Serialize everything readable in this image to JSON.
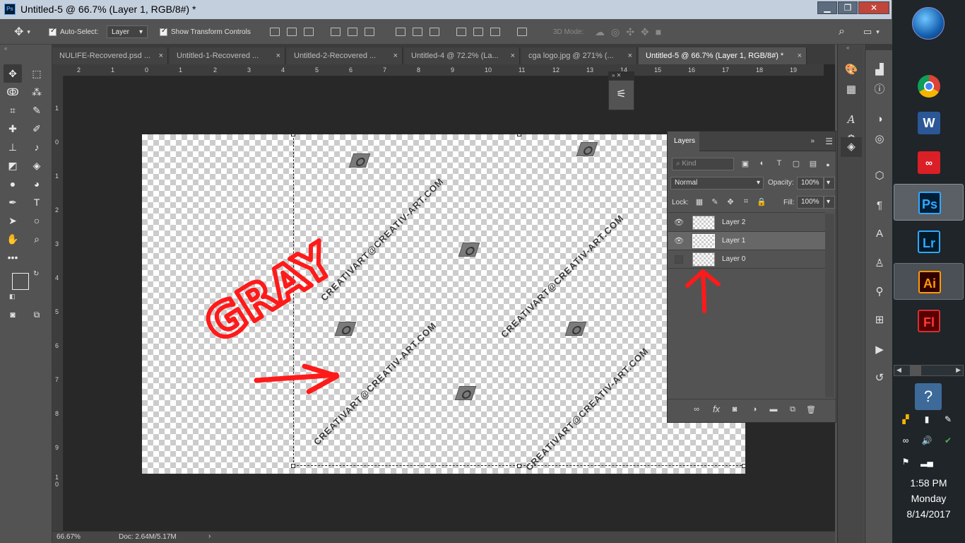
{
  "window": {
    "title": "Untitled-5 @ 66.7% (Layer 1, RGB/8#) *",
    "app_icon": "Ps",
    "min": "▁",
    "restore": "❐",
    "close": "✕"
  },
  "options": {
    "auto_select_label": "Auto-Select:",
    "auto_select_value": "Layer",
    "show_transform_label": "Show Transform Controls",
    "mode_3d_label": "3D Mode:"
  },
  "tabs": [
    {
      "label": "NULIFE-Recovered.psd ...",
      "close": "×"
    },
    {
      "label": "Untitled-1-Recovered ...",
      "close": "×"
    },
    {
      "label": "Untitled-2-Recovered ...",
      "close": "×"
    },
    {
      "label": "Untitled-4 @ 72.2% (La...",
      "close": "×"
    },
    {
      "label": "cga logo.jpg @ 271% (...",
      "close": "×"
    },
    {
      "label": "Untitled-5 @ 66.7% (Layer 1, RGB/8#) *",
      "close": "×"
    }
  ],
  "ruler_top": [
    "2",
    "1",
    "0",
    "1",
    "2",
    "3",
    "4",
    "5",
    "6",
    "7",
    "8",
    "9",
    "10",
    "11",
    "12",
    "13",
    "14",
    "15",
    "16",
    "17",
    "18",
    "19"
  ],
  "ruler_left": [
    "1",
    "0",
    "1",
    "2",
    "3",
    "4",
    "5",
    "6",
    "7",
    "8",
    "9",
    "1\n0"
  ],
  "canvas": {
    "watermark": "CREATIVART@CREATIV-ART.COM",
    "annotation_text": "GRAY"
  },
  "status": {
    "zoom": "66.67%",
    "doc": "Doc: 2.64M/5.17M",
    "arrow": "›"
  },
  "layers_panel": {
    "tab_label": "Layers",
    "kind_placeholder": "Kind",
    "blend_mode": "Normal",
    "opacity_label": "Opacity:",
    "opacity_value": "100%",
    "lock_label": "Lock:",
    "fill_label": "Fill:",
    "fill_value": "100%",
    "layers": [
      {
        "name": "Layer 2",
        "visible": true,
        "selected": false
      },
      {
        "name": "Layer 1",
        "visible": true,
        "selected": true
      },
      {
        "name": "Layer 0",
        "visible": false,
        "selected": false
      }
    ]
  },
  "taskbar": {
    "apps": [
      {
        "name": "chrome",
        "label": ""
      },
      {
        "name": "word",
        "label": "W"
      },
      {
        "name": "creative-cloud",
        "label": ""
      },
      {
        "name": "photoshop",
        "label": "Ps"
      },
      {
        "name": "lightroom",
        "label": "Lr"
      },
      {
        "name": "illustrator",
        "label": "Ai"
      },
      {
        "name": "flash",
        "label": "Fl"
      }
    ],
    "time": "1:58 PM",
    "day": "Monday",
    "date": "8/14/2017"
  },
  "colors": {
    "annotation_red": "#ff1a1a",
    "ps_blue": "#31a8ff",
    "ai_orange": "#ff9a00"
  }
}
